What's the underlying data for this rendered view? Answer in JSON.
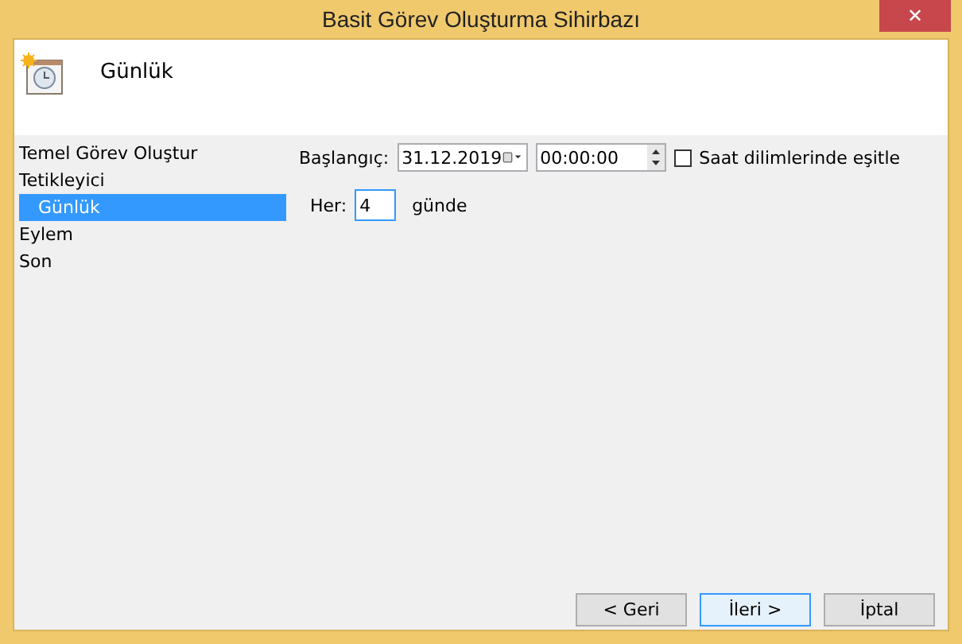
{
  "window": {
    "title": "Basit Görev Oluşturma Sihirbazı",
    "close": "✕"
  },
  "header": {
    "title": "Günlük"
  },
  "sidebar": {
    "items": [
      {
        "label": "Temel Görev Oluştur",
        "selected": false
      },
      {
        "label": "Tetikleyici",
        "selected": false,
        "children": [
          {
            "label": "Günlük",
            "selected": true
          }
        ]
      },
      {
        "label": "Eylem",
        "selected": false
      },
      {
        "label": "Son",
        "selected": false
      }
    ]
  },
  "form": {
    "start_label": "Başlangıç:",
    "date": "31.12.2019",
    "time": "00:00:00",
    "sync": {
      "label": "Saat dilimlerinde eşitle",
      "checked": false
    },
    "every_label": "Her:",
    "every_value": "4",
    "every_unit": "günde"
  },
  "buttons": [
    {
      "label": "< Geri",
      "focused": false
    },
    {
      "label": "İleri >",
      "focused": true
    },
    {
      "label": "İptal",
      "focused": false
    }
  ]
}
